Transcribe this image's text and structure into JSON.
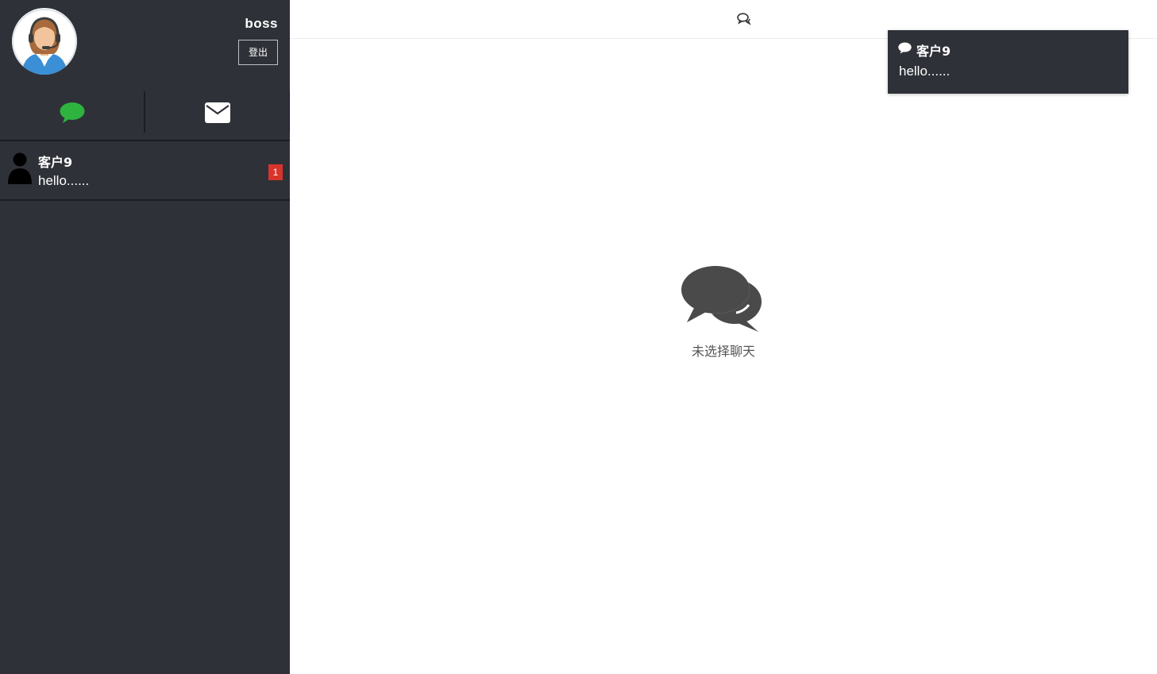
{
  "user": {
    "name": "boss",
    "logout_label": "登出"
  },
  "tabs": [
    {
      "icon": "chat-bubble-icon",
      "active": true,
      "color": "#2fb33f"
    },
    {
      "icon": "envelope-icon",
      "active": false,
      "color": "#ffffff"
    }
  ],
  "conversations": [
    {
      "name": "客户9",
      "preview": "hello......",
      "unread": "1",
      "icon": "person-icon"
    }
  ],
  "main": {
    "empty_text": "未选择聊天",
    "header_icon": "chat-bubbles-icon"
  },
  "toast": {
    "icon": "chat-bubble-icon",
    "title": "客户9",
    "body": "hello......"
  },
  "colors": {
    "sidebar_bg": "#2f3139",
    "active_tab": "#2fb33f",
    "badge": "#d9342b"
  }
}
